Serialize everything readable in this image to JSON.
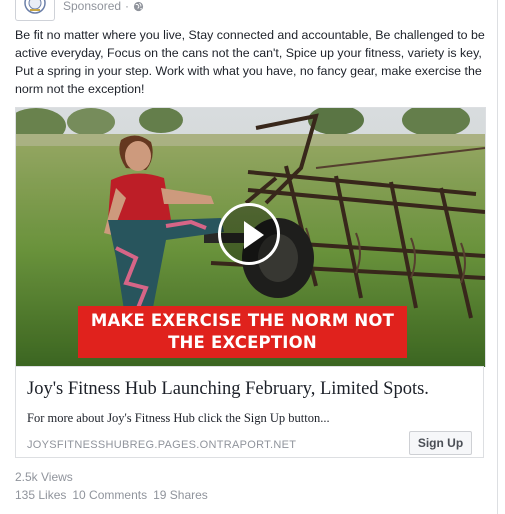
{
  "header": {
    "sponsored_label": "Sponsored",
    "separator": "·",
    "audience_icon": "globe-icon"
  },
  "post": {
    "text": "Be fit no matter where you live, Stay connected and accountable, Be challenged to be active everyday, Focus on the cans not the can't, Spice up your fitness, variety is key, Put a spring in your step. Work with what you have, no fancy gear, make exercise the norm not the exception!"
  },
  "video": {
    "banner_line1": "MAKE EXERCISE THE NORM NOT",
    "banner_line2": "THE EXCEPTION",
    "play_icon": "play-icon",
    "banner_color": "#e0221d"
  },
  "link": {
    "title": "Joy's Fitness Hub Launching February, Limited Spots.",
    "description": "For more about Joy's Fitness Hub click the Sign Up button...",
    "domain": "JOYSFITNESSHUBREG.PAGES.ONTRAPORT.NET",
    "cta_label": "Sign Up"
  },
  "engagement": {
    "views": "2.5k Views",
    "likes": "135 Likes",
    "comments": "10 Comments",
    "shares": "19 Shares"
  },
  "colors": {
    "text": "#1d2129",
    "meta": "#90949c",
    "border": "#dddfe2"
  }
}
